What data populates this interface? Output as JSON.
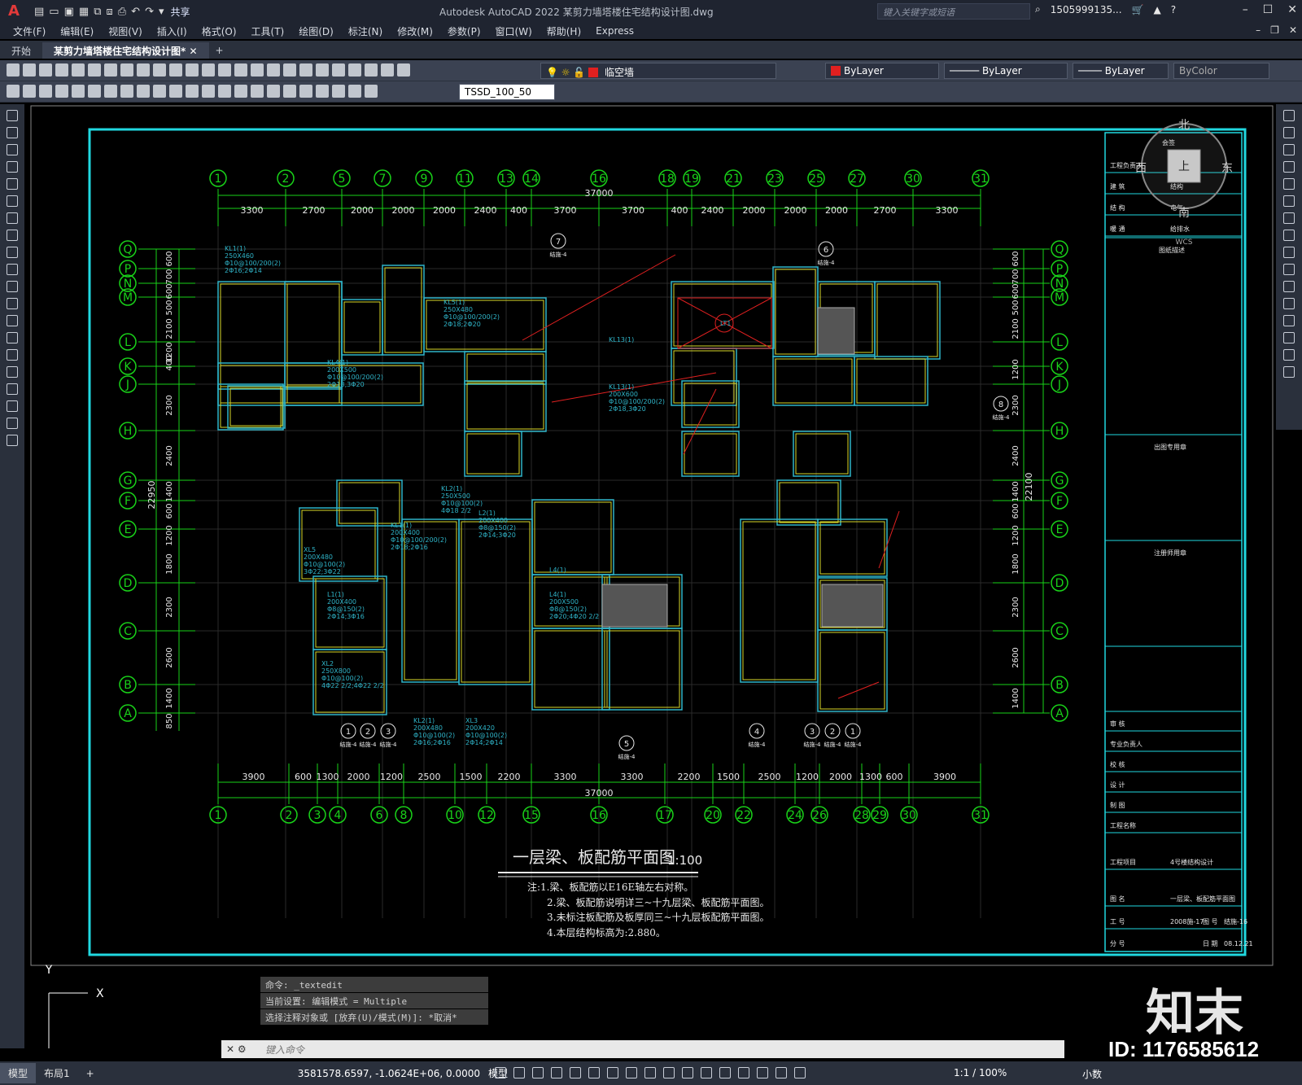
{
  "app": {
    "title": "Autodesk AutoCAD 2022    某剪力墙塔楼住宅结构设计图.dwg",
    "share": "共享",
    "search_placeholder": "键入关键字或短语",
    "user": "1505999135...",
    "help": "?"
  },
  "menu": [
    "文件(F)",
    "编辑(E)",
    "视图(V)",
    "插入(I)",
    "格式(O)",
    "工具(T)",
    "绘图(D)",
    "标注(N)",
    "修改(M)",
    "参数(P)",
    "窗口(W)",
    "帮助(H)",
    "Express"
  ],
  "tabs": {
    "start": "开始",
    "doc": "某剪力墙塔楼住宅结构设计图*",
    "add": "+"
  },
  "toolbar": {
    "layer": "临空墙",
    "color": "ByLayer",
    "linetype": "ByLayer",
    "lineweight": "ByLayer",
    "plotstyle": "ByColor",
    "dimstyle": "TSSD_100_50"
  },
  "compass": {
    "north": "北",
    "south": "南",
    "east": "东",
    "west": "西",
    "top": "上",
    "wcs": "WCS"
  },
  "drawing": {
    "top_axes": [
      "1",
      "2",
      "5",
      "7",
      "9",
      "11",
      "13",
      "14",
      "16",
      "18",
      "19",
      "21",
      "23",
      "25",
      "27",
      "30",
      "31"
    ],
    "top_dims": [
      "3300",
      "2700",
      "2000",
      "2000",
      "2000",
      "2400",
      "400",
      "3700",
      "3700",
      "400",
      "2400",
      "2000",
      "2000",
      "2000",
      "2700",
      "3300"
    ],
    "total_dim": "37000",
    "bottom_axes": [
      "1",
      "2",
      "3",
      "4",
      "6",
      "8",
      "10",
      "12",
      "15",
      "16",
      "17",
      "20",
      "22",
      "24",
      "26",
      "28",
      "29",
      "30",
      "31"
    ],
    "bottom_dims": [
      "3900",
      "600",
      "1300",
      "2000",
      "1200",
      "2500",
      "1500",
      "2200",
      "3300",
      "3300",
      "2200",
      "1500",
      "2500",
      "1200",
      "2000",
      "1300",
      "600",
      "3900"
    ],
    "row_axes": [
      "Q",
      "P",
      "N",
      "M",
      "L",
      "K",
      "J",
      "H",
      "G",
      "F",
      "E",
      "D",
      "C",
      "B",
      "A"
    ],
    "left_dims": [
      "600",
      "700",
      "600",
      "500",
      "2100",
      "1200",
      "400",
      "2300",
      "2400",
      "1400",
      "600",
      "1200",
      "1800",
      "2300",
      "2600",
      "1400",
      "850"
    ],
    "left_total": "22950",
    "right_total": "22100",
    "right_dims": [
      "600",
      "700",
      "600",
      "500",
      "2100",
      "1200",
      "2300",
      "2400",
      "1400",
      "600",
      "1200",
      "1800",
      "2300",
      "2600",
      "1400"
    ],
    "beam_labels": [
      "KL1(1)\n250X460\nΦ10@100/200(2)\n2Φ16;2Φ14",
      "KL5(1)\n250X480\nΦ10@100/200(2)\n2Φ18;2Φ20",
      "KL13(1)",
      "KL13(1)\n200X600\nΦ10@100/200(2)\n2Φ18,3Φ20",
      "KL4(1)\n200X500\nΦ10@100/200(2)\n2Φ18,3Φ20",
      "KL2(1)\n250X500\nΦ10@100(2)\n4Φ18 2/2",
      "KL1(1)\n200X400\nΦ10@100/200(2)\n2Φ18;2Φ16",
      "XL5\n200X480\nΦ10@100(2)\n3Φ22;3Φ22",
      "L1(1)\n200X400\nΦ8@150(2)\n2Φ14;3Φ16",
      "XL2\n250X800\nΦ10@100(2)\n4Φ22 2/2;4Φ22 2/2",
      "L4(1)\n200X500\nΦ8@150(2)\n2Φ20;4Φ20 2/2",
      "L2(1)\n200X400\nΦ8@150(2)\n2Φ14;3Φ20",
      "KL2(1)\n200X480\nΦ10@100(2)\n2Φ16;2Φ16",
      "XL3\n200X420\nΦ10@100(2)\n2Φ14;2Φ14",
      "L4(1)",
      "LT1"
    ],
    "section_marks": [
      "7",
      "6",
      "8",
      "5",
      "1",
      "2",
      "3",
      "4",
      "3",
      "2",
      "1"
    ],
    "section_sub": "结施-4",
    "plan_title": "一层梁、板配筋平面图",
    "plan_scale": "1:100",
    "notes": [
      "注:1.梁、板配筋以E16E轴左右对称。",
      "2.梁、板配筋说明详三~十九层梁、板配筋平面图。",
      "3.未标注板配筋及板厚同三~十九层板配筋平面图。",
      "4.本层结构标高为:2.880。"
    ]
  },
  "title_block": {
    "header": "会签",
    "rows": [
      {
        "label": "工程负责人",
        "value": ""
      },
      {
        "label": "建 筑",
        "value": "结构"
      },
      {
        "label": "结 构",
        "value": "电气"
      },
      {
        "label": "暖 通",
        "value": "给排水"
      }
    ],
    "drawing_desc": "图纸描述",
    "stamp1": "出图专用章",
    "stamp2": "注册师用章",
    "sign_rows": [
      "审 核",
      "专业负责人",
      "校 核",
      "设 计",
      "制 图"
    ],
    "project_name_label": "工程名称",
    "project_item_label": "工程项目",
    "project_item_value": "4号楼结构设计",
    "drawing_name_label": "图 名",
    "drawing_name_value": "一层梁、板配筋平面图",
    "job_no_label": "工 号",
    "job_no_value": "2008施-17",
    "drawing_no_label": "图 号",
    "drawing_no_value": "结施-16",
    "sheet_label": "分 号",
    "date_label": "日 期",
    "date_value": "08.12.21"
  },
  "command": {
    "history": [
      "命令: _textedit",
      "当前设置: 编辑模式 = Multiple",
      "选择注释对象或 [放弃(U)/模式(M)]: *取消*"
    ],
    "placeholder": "键入命令"
  },
  "status": {
    "tabs": [
      "模型",
      "布局1",
      "+"
    ],
    "coords": "3581578.6597, -1.0624E+06, 0.0000",
    "space": "模型",
    "scale": "1:1 / 100%",
    "units": "小数"
  },
  "watermark": {
    "id": "ID: 1176585612",
    "logo": "知末"
  },
  "colors": {
    "axis": "#19d219",
    "beam": "#d8d82a",
    "wall": "#2fb4c8",
    "frame": "#20d8e0",
    "section": "#e02020",
    "text": "#e8e8e8"
  }
}
